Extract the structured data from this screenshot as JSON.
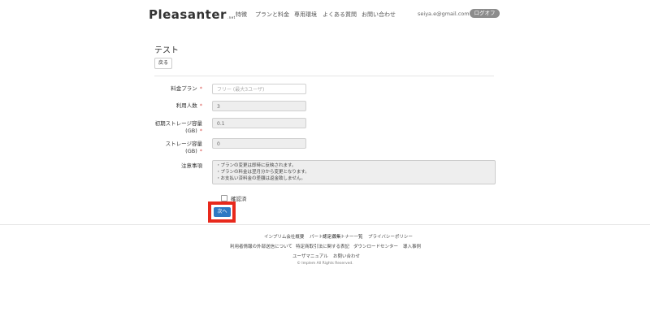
{
  "header": {
    "logo": "Pleasanter",
    "logo_suffix": ".net",
    "nav": [
      "特徴",
      "プランと料金",
      "専用環境",
      "よくある質問",
      "お問い合わせ"
    ],
    "email": "seiya.e@gmail.com",
    "logout_label": "ログオフ"
  },
  "main": {
    "title": "テスト",
    "back_label": "戻る",
    "fields": [
      {
        "label": "料金プラン",
        "required": "*",
        "value": "フリー (最大3ユーザ)",
        "readonly": false
      },
      {
        "label": "利用人数",
        "required": "*",
        "value": "3",
        "readonly": true
      },
      {
        "label": "初期ストレージ容量(GB)",
        "required": "*",
        "value": "0.1",
        "readonly": true
      },
      {
        "label": "ストレージ容量(GB)",
        "required": "*",
        "value": "0",
        "readonly": true
      }
    ],
    "notes": {
      "label": "注意事項",
      "lines": [
        "・プランの変更は即時に反映されます。",
        "・プランの料金は翌月分から変更となります。",
        "・お支払い済料金の差額は返金致しません。"
      ]
    },
    "confirm_label": "確認済",
    "next_label": "次へ"
  },
  "footer": {
    "row1": [
      "インプリム会社概要",
      "パートナー募集",
      "認定パートナー一覧",
      "プライバシーポリシー"
    ],
    "row2": [
      "利用者情報の外部送信について",
      "特定商取引法に関する表記",
      "ダウンロードセンター",
      "導入事例"
    ],
    "row3": [
      "ユーザマニュアル",
      "お問い合わせ"
    ],
    "copyright": "© Implem All Rights Reserved."
  }
}
